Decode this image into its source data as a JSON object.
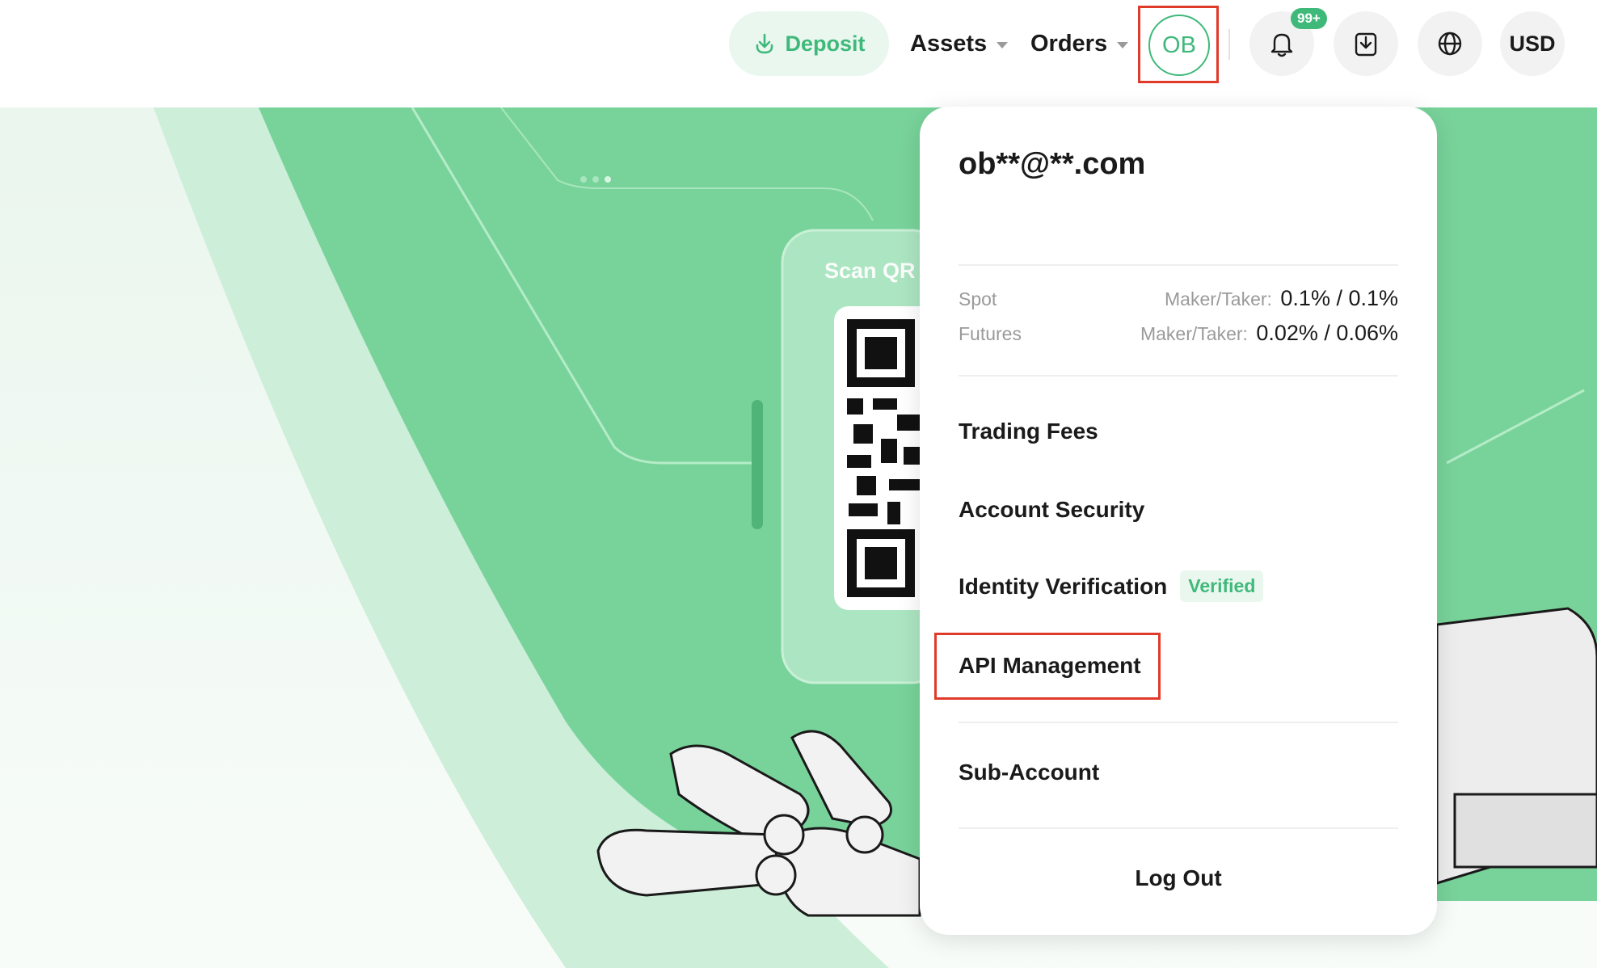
{
  "header": {
    "deposit_label": "Deposit",
    "assets_label": "Assets",
    "orders_label": "Orders",
    "avatar_initials": "OB",
    "notification_badge": "99+",
    "currency_label": "USD"
  },
  "hero": {
    "scan_text": "Scan QR"
  },
  "account_menu": {
    "email": "ob**@**.com",
    "fees": [
      {
        "label": "Spot",
        "prefix": "Maker/Taker:",
        "value": "0.1% / 0.1%"
      },
      {
        "label": "Futures",
        "prefix": "Maker/Taker:",
        "value": "0.02% / 0.06%"
      }
    ],
    "items": {
      "trading_fees": "Trading Fees",
      "account_security": "Account Security",
      "identity_verification": "Identity Verification",
      "verified_badge": "Verified",
      "api_management": "API Management",
      "sub_account": "Sub-Account",
      "log_out": "Log Out"
    }
  },
  "colors": {
    "brand_green": "#3fb97a",
    "hero_green": "#78d39a",
    "highlight_red": "#e03a2a"
  },
  "icons": [
    "download-arrow-icon",
    "bell-icon",
    "download-tray-icon",
    "globe-icon",
    "caret-down-icon"
  ]
}
